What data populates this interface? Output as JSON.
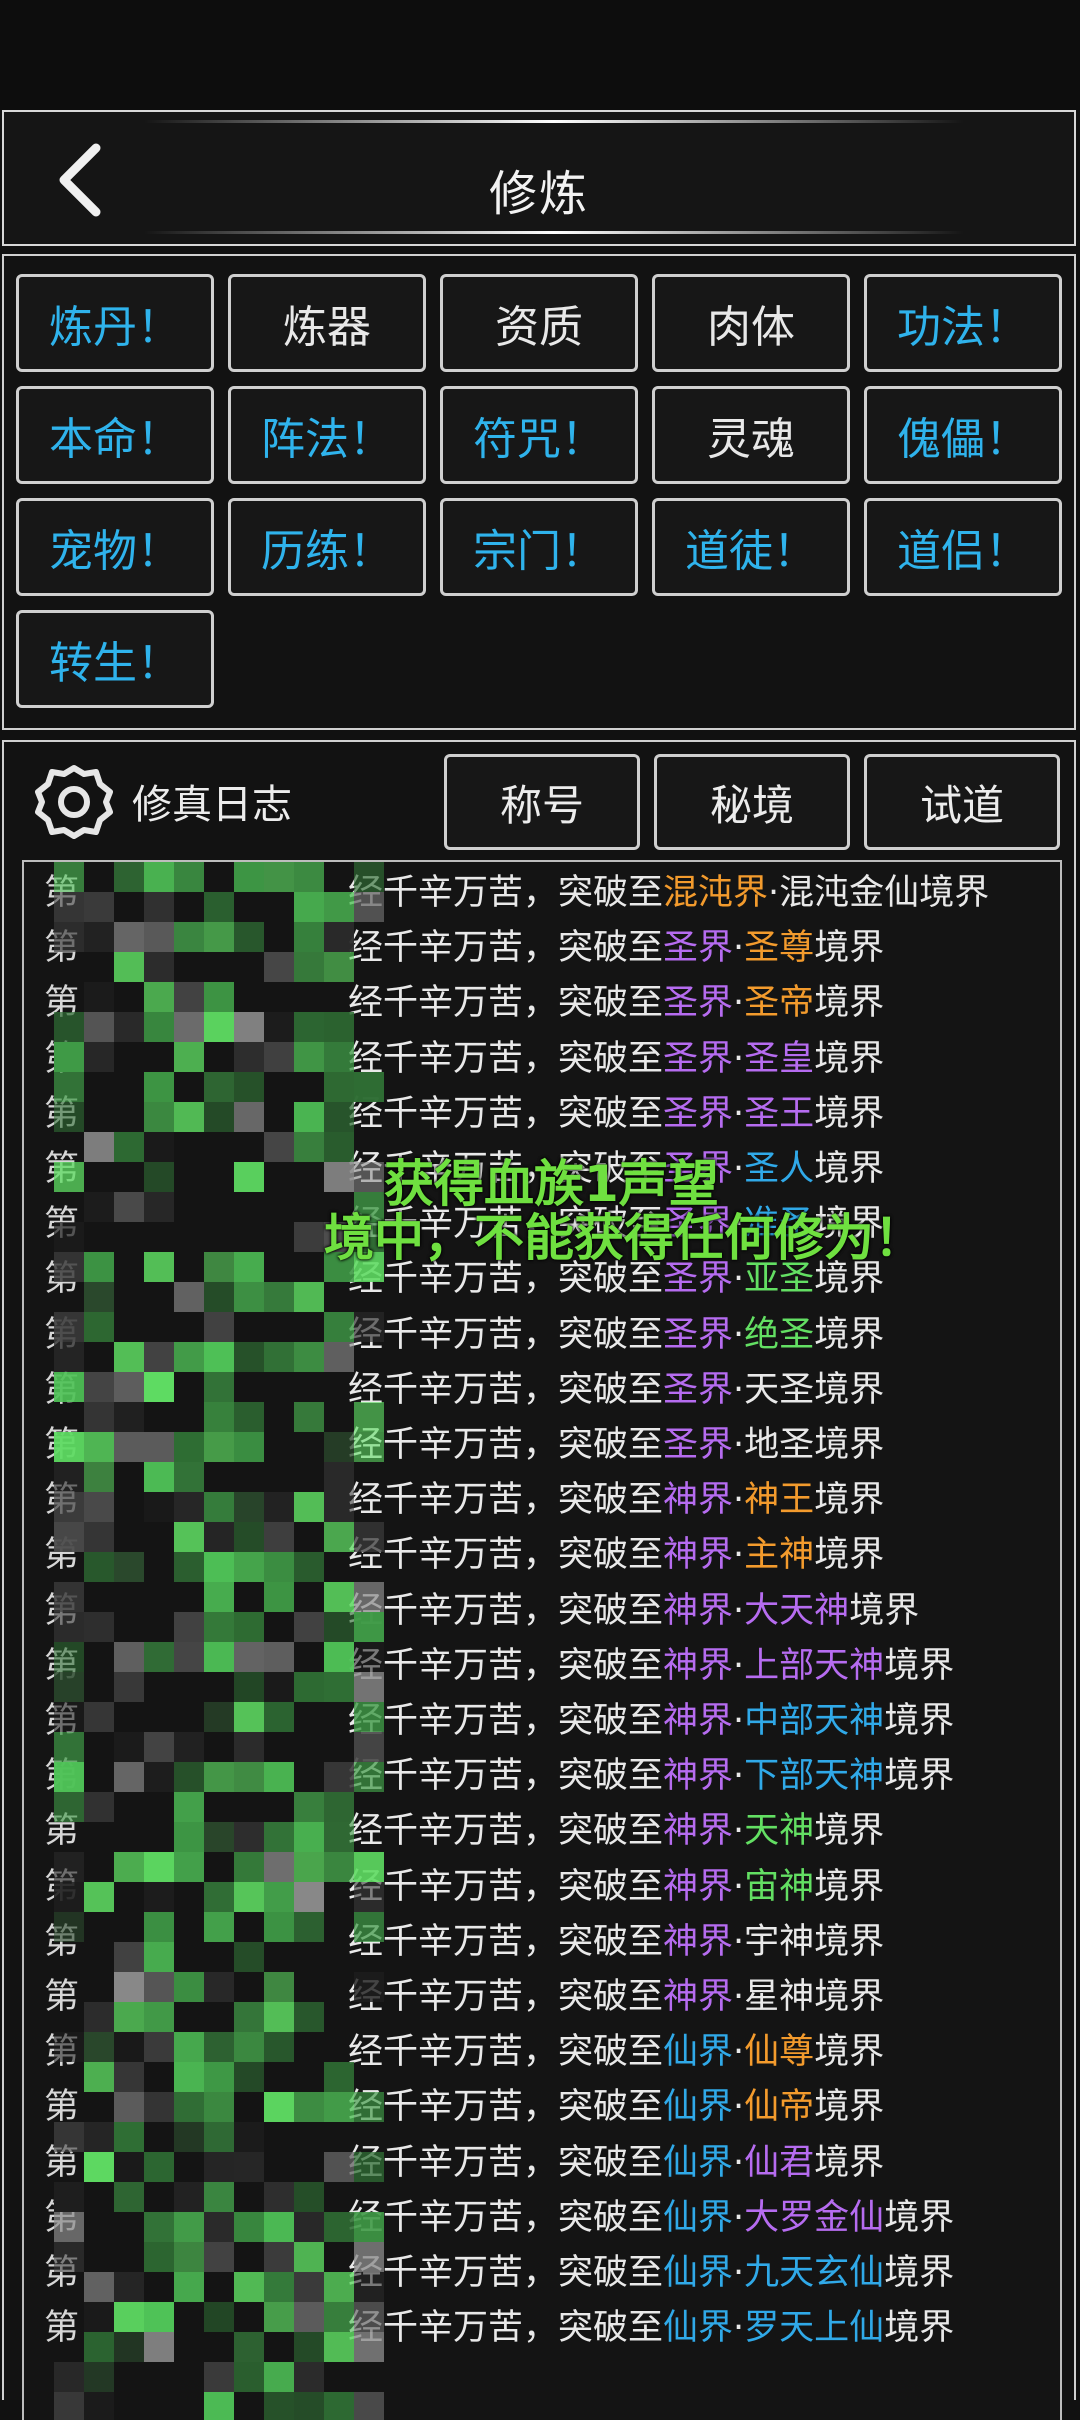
{
  "header": {
    "title": "修炼",
    "back_icon": "back-arrow-icon"
  },
  "tabs": [
    {
      "label": "炼丹！",
      "alert": true
    },
    {
      "label": "炼器",
      "alert": false
    },
    {
      "label": "资质",
      "alert": false
    },
    {
      "label": "肉体",
      "alert": false
    },
    {
      "label": "功法！",
      "alert": true
    },
    {
      "label": "本命！",
      "alert": true
    },
    {
      "label": "阵法！",
      "alert": true
    },
    {
      "label": "符咒！",
      "alert": true
    },
    {
      "label": "灵魂",
      "alert": false
    },
    {
      "label": "傀儡！",
      "alert": true
    },
    {
      "label": "宠物！",
      "alert": true
    },
    {
      "label": "历练！",
      "alert": true
    },
    {
      "label": "宗门！",
      "alert": true
    },
    {
      "label": "道徒！",
      "alert": true
    },
    {
      "label": "道侣！",
      "alert": true
    },
    {
      "label": "转生！",
      "alert": true
    }
  ],
  "log_header": {
    "settings_icon": "gear-icon",
    "title": "修真日志",
    "buttons": [
      "称号",
      "秘境",
      "试道"
    ]
  },
  "log": {
    "prefix": "第",
    "prefix_tail": "万",
    "phrase": "经千辛万苦，突破至",
    "suffix": "境界",
    "entries": [
      {
        "realm": "混沌界",
        "realm_color": "#f39b2d",
        "rank": "混沌金仙",
        "rank_color": "#e9e9e9",
        "suffix": "境界"
      },
      {
        "realm": "圣界",
        "realm_color": "#b66cf0",
        "rank": "圣尊",
        "rank_color": "#f39b2d",
        "suffix": "境界"
      },
      {
        "realm": "圣界",
        "realm_color": "#b66cf0",
        "rank": "圣帝",
        "rank_color": "#f39b2d",
        "suffix": "境界"
      },
      {
        "realm": "圣界",
        "realm_color": "#b66cf0",
        "rank": "圣皇",
        "rank_color": "#b66cf0",
        "suffix": "境界"
      },
      {
        "realm": "圣界",
        "realm_color": "#b66cf0",
        "rank": "圣王",
        "rank_color": "#b66cf0",
        "suffix": "境界"
      },
      {
        "realm": "圣界",
        "realm_color": "#b66cf0",
        "rank": "圣人",
        "rank_color": "#30a9e8",
        "suffix": "境界"
      },
      {
        "realm": "圣界",
        "realm_color": "#b66cf0",
        "rank": "准圣",
        "rank_color": "#30a9e8",
        "suffix": "境界"
      },
      {
        "realm": "圣界",
        "realm_color": "#b66cf0",
        "rank": "亚圣",
        "rank_color": "#63df63",
        "suffix": "境界"
      },
      {
        "realm": "圣界",
        "realm_color": "#b66cf0",
        "rank": "绝圣",
        "rank_color": "#63df63",
        "suffix": "境界"
      },
      {
        "realm": "圣界",
        "realm_color": "#b66cf0",
        "rank": "天圣",
        "rank_color": "#e9e9e9",
        "suffix": "境界"
      },
      {
        "realm": "圣界",
        "realm_color": "#b66cf0",
        "rank": "地圣",
        "rank_color": "#e9e9e9",
        "suffix": "境界"
      },
      {
        "realm": "神界",
        "realm_color": "#b66cf0",
        "rank": "神王",
        "rank_color": "#f39b2d",
        "suffix": "境界"
      },
      {
        "realm": "神界",
        "realm_color": "#b66cf0",
        "rank": "主神",
        "rank_color": "#f39b2d",
        "suffix": "境界"
      },
      {
        "realm": "神界",
        "realm_color": "#b66cf0",
        "rank": "大天神",
        "rank_color": "#b66cf0",
        "suffix": "境界"
      },
      {
        "realm": "神界",
        "realm_color": "#b66cf0",
        "rank": "上部天神",
        "rank_color": "#b66cf0",
        "suffix": "境界"
      },
      {
        "realm": "神界",
        "realm_color": "#b66cf0",
        "rank": "中部天神",
        "rank_color": "#30a9e8",
        "suffix": "境界"
      },
      {
        "realm": "神界",
        "realm_color": "#b66cf0",
        "rank": "下部天神",
        "rank_color": "#30a9e8",
        "suffix": "境界"
      },
      {
        "realm": "神界",
        "realm_color": "#b66cf0",
        "rank": "天神",
        "rank_color": "#63df63",
        "suffix": "境界"
      },
      {
        "realm": "神界",
        "realm_color": "#b66cf0",
        "rank": "宙神",
        "rank_color": "#63df63",
        "suffix": "境界"
      },
      {
        "realm": "神界",
        "realm_color": "#b66cf0",
        "rank": "宇神",
        "rank_color": "#e9e9e9",
        "suffix": "境界"
      },
      {
        "realm": "神界",
        "realm_color": "#b66cf0",
        "rank": "星神",
        "rank_color": "#e9e9e9",
        "suffix": "境界"
      },
      {
        "realm": "仙界",
        "realm_color": "#30a9e8",
        "rank": "仙尊",
        "rank_color": "#f39b2d",
        "suffix": "境界"
      },
      {
        "realm": "仙界",
        "realm_color": "#30a9e8",
        "rank": "仙帝",
        "rank_color": "#f39b2d",
        "suffix": "境界"
      },
      {
        "realm": "仙界",
        "realm_color": "#30a9e8",
        "rank": "仙君",
        "rank_color": "#b66cf0",
        "suffix": "境界"
      },
      {
        "realm": "仙界",
        "realm_color": "#30a9e8",
        "rank": "大罗金仙",
        "rank_color": "#b66cf0",
        "suffix": "境界"
      },
      {
        "realm": "仙界",
        "realm_color": "#30a9e8",
        "rank": "九天玄仙",
        "rank_color": "#30a9e8",
        "suffix": "境界"
      },
      {
        "realm": "仙界",
        "realm_color": "#30a9e8",
        "rank": "罗天上仙",
        "rank_color": "#30a9e8",
        "suffix": "境界"
      }
    ]
  },
  "overlay": {
    "line1": "获得血族1声望",
    "line2": "境中，不能获得任何修为！",
    "color": "#6fe040"
  },
  "colors": {
    "alert_blue": "#2fb3ec",
    "background": "#111111",
    "border": "#cfcfcf"
  }
}
